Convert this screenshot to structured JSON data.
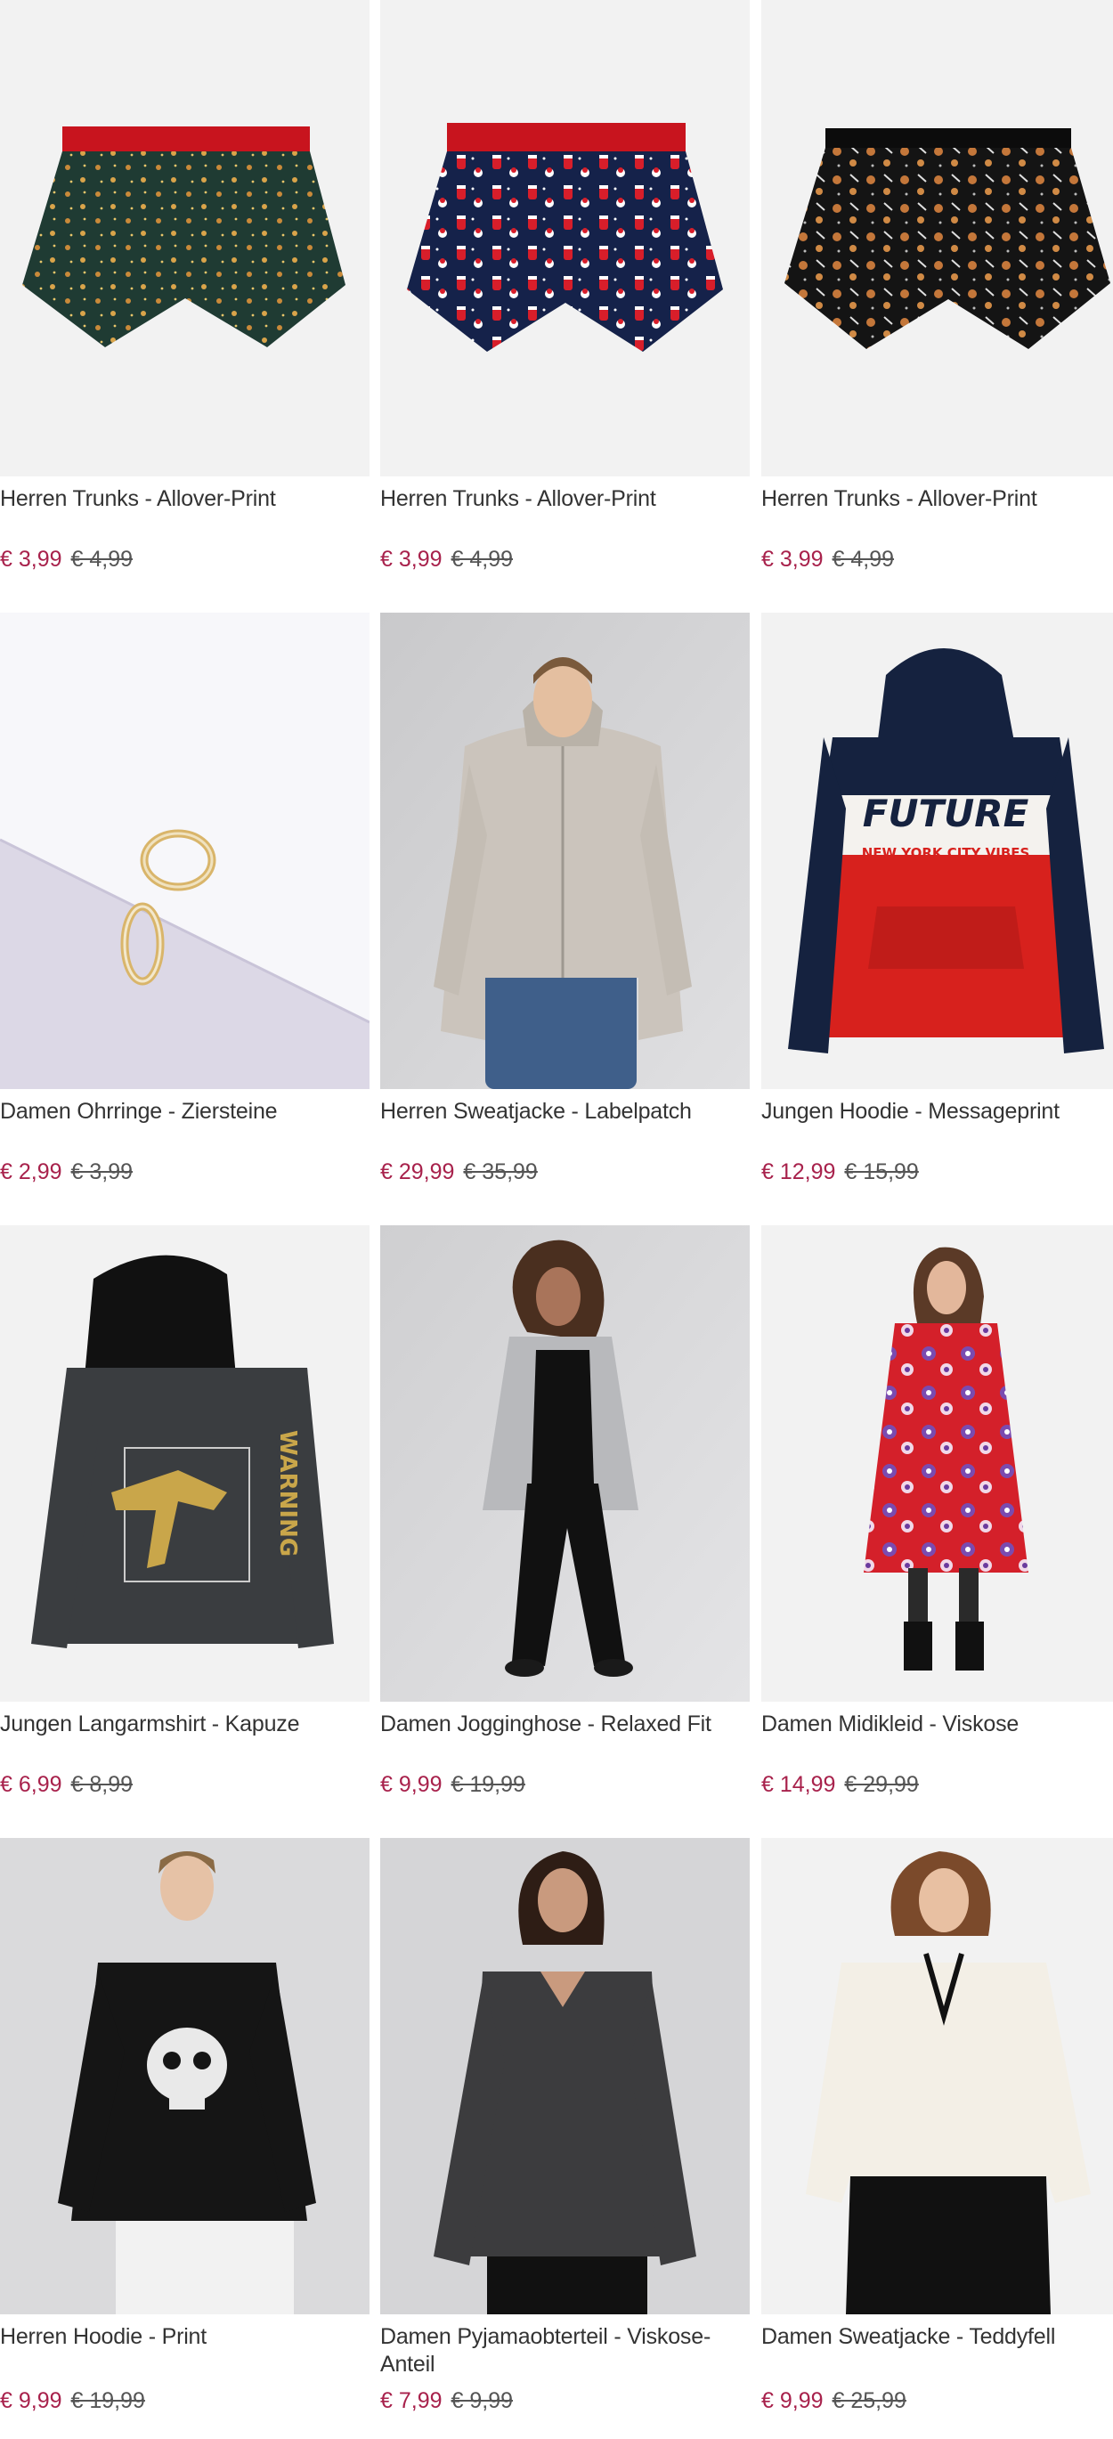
{
  "products": [
    {
      "title": "Herren Trunks - Allover-Print",
      "price": "€ 3,99",
      "old_price": "€ 4,99",
      "image": "green-trunks-image"
    },
    {
      "title": "Herren Trunks - Allover-Print",
      "price": "€ 3,99",
      "old_price": "€ 4,99",
      "image": "navy-trunks-image"
    },
    {
      "title": "Herren Trunks - Allover-Print",
      "price": "€ 3,99",
      "old_price": "€ 4,99",
      "image": "black-trunks-image"
    },
    {
      "title": "Damen Ohrringe - Ziersteine",
      "price": "€ 2,99",
      "old_price": "€ 3,99",
      "image": "earrings-image"
    },
    {
      "title": "Herren Sweatjacke - Labelpatch",
      "price": "€ 29,99",
      "old_price": "€ 35,99",
      "image": "sweatjacket-man-image"
    },
    {
      "title": "Jungen Hoodie - Messageprint",
      "price": "€ 12,99",
      "old_price": "€ 15,99",
      "image": "future-hoodie-image"
    },
    {
      "title": "Jungen Langarmshirt - Kapuze",
      "price": "€ 6,99",
      "old_price": "€ 8,99",
      "image": "dino-shirt-image"
    },
    {
      "title": "Damen Jogginghose - Relaxed Fit",
      "price": "€ 9,99",
      "old_price": "€ 19,99",
      "image": "jogginghose-woman-image"
    },
    {
      "title": "Damen Midikleid - Viskose",
      "price": "€ 14,99",
      "old_price": "€ 29,99",
      "image": "midikleid-woman-image"
    },
    {
      "title": "Herren Hoodie - Print",
      "price": "€ 9,99",
      "old_price": "€ 19,99",
      "image": "skull-hoodie-man-image"
    },
    {
      "title": "Damen Pyjamaobterteil - Viskose-Anteil",
      "price": "€ 7,99",
      "old_price": "€ 9,99",
      "image": "pyjama-top-woman-image"
    },
    {
      "title": "Damen Sweatjacke - Teddyfell",
      "price": "€ 9,99",
      "old_price": "€ 25,99",
      "image": "teddy-jacket-woman-image"
    }
  ],
  "print_texts": {
    "future": "FUTURE",
    "future_sub": "NEW YORK CITY VIBES",
    "dino": "WARNING"
  },
  "colors": {
    "price_now": "#a8224c",
    "price_old": "#555555",
    "title": "#333333"
  }
}
